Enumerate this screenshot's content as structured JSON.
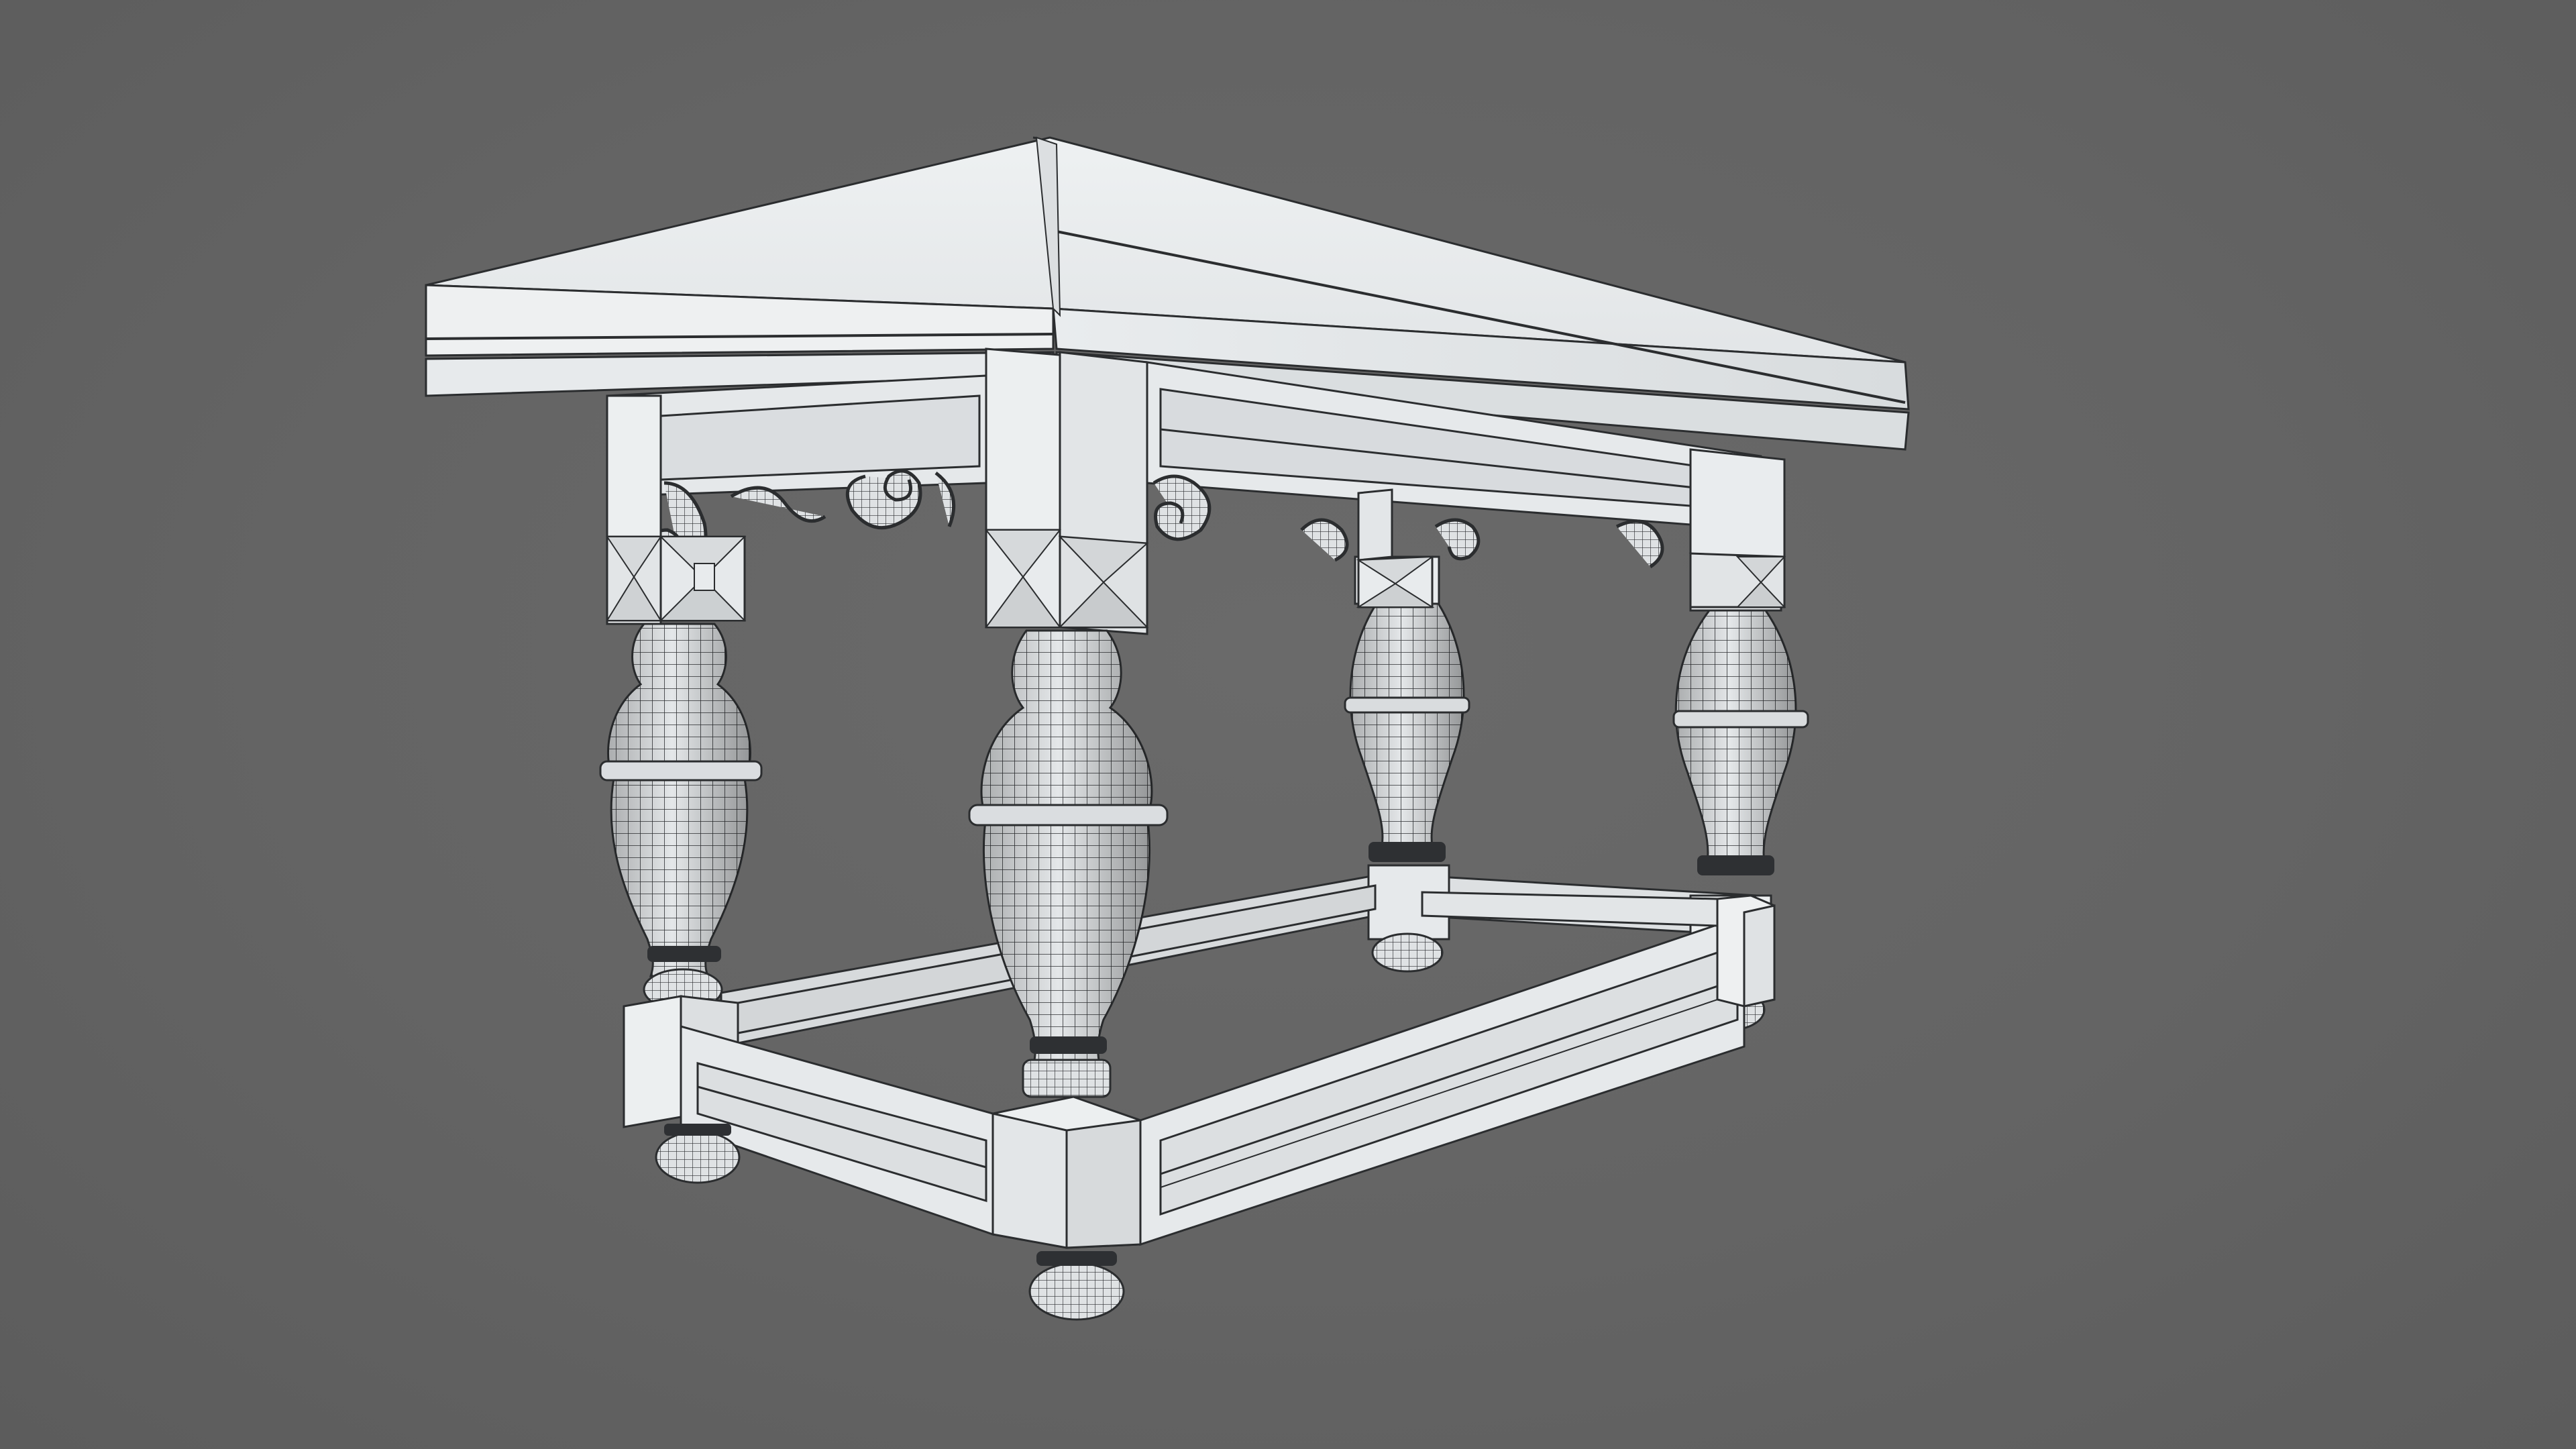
{
  "viewport": {
    "background_color": "#646464"
  },
  "model": {
    "object": "table",
    "render_style": "clay-wireframe",
    "material_color": "#e3e6e8",
    "wire_color": "#2b2d2f",
    "visible_legs": 4,
    "parts": [
      "tabletop",
      "apron",
      "corner-blocks",
      "carved-brackets",
      "turned-legs",
      "stretcher-frame",
      "bun-feet"
    ]
  }
}
